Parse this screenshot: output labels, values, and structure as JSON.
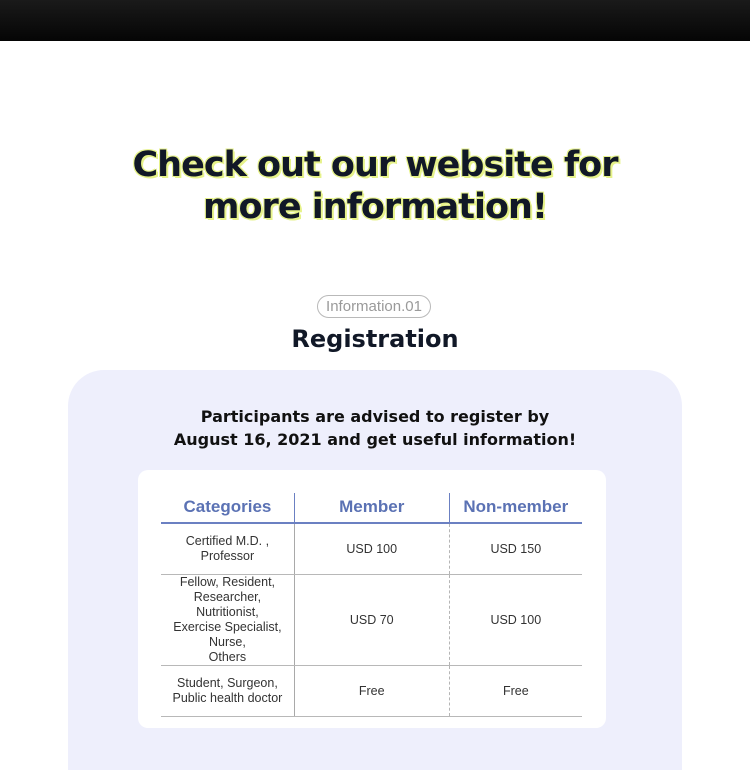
{
  "headline": {
    "line1": "Check out our website for",
    "line2": "more information!"
  },
  "section": {
    "badge": "Information.01",
    "title": "Registration"
  },
  "notice": {
    "line1": "Participants are advised to register by",
    "line2": "August 16, 2021 and get useful information!"
  },
  "fees_table": {
    "headers": [
      "Categories",
      "Member",
      "Non-member"
    ],
    "rows": [
      {
        "category": [
          "Certified M.D. ,",
          "Professor"
        ],
        "member": "USD 100",
        "non_member": "USD 150"
      },
      {
        "category": [
          "Fellow, Resident,",
          "Researcher, Nutritionist,",
          "Exercise Specialist, Nurse,",
          "Others"
        ],
        "member": "USD 70",
        "non_member": "USD 100"
      },
      {
        "category": [
          "Student, Surgeon,",
          "Public health doctor"
        ],
        "member": "Free",
        "non_member": "Free"
      }
    ]
  },
  "colors": {
    "accent": "#5b72b4",
    "panel_bg": "#eeeffc",
    "headline_glow": "#e6f28a"
  }
}
